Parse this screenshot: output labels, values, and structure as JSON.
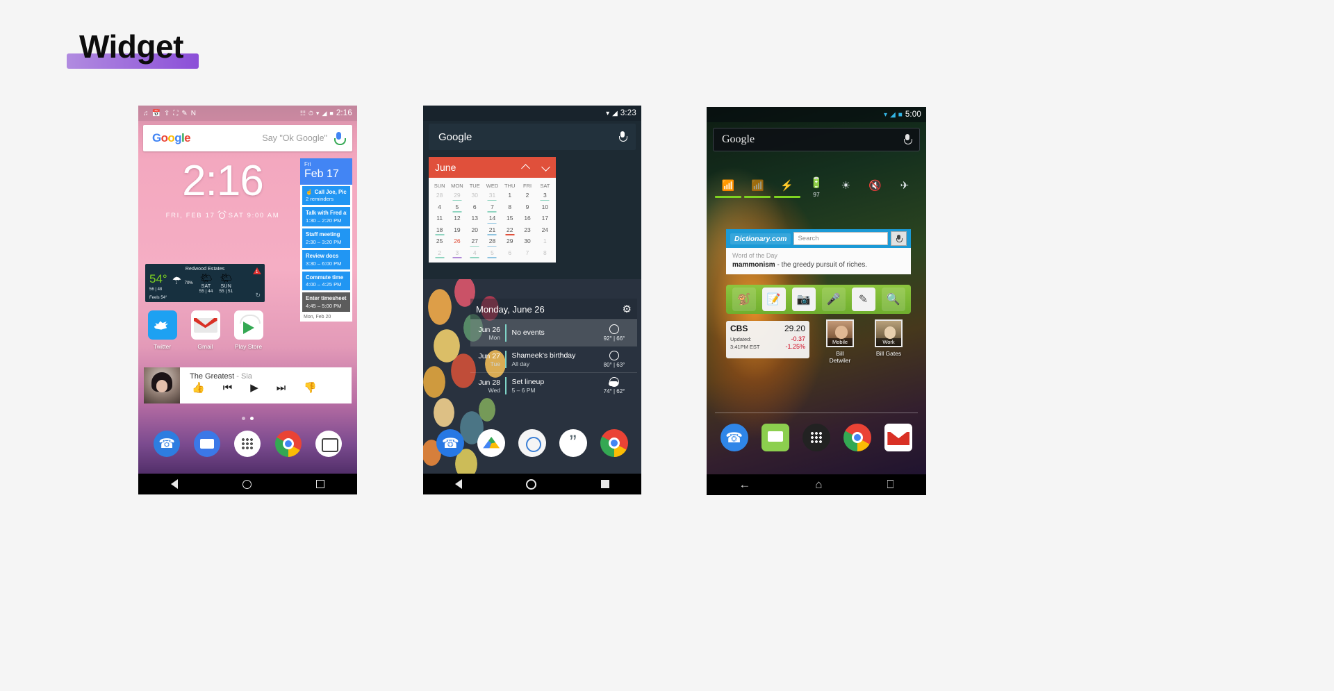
{
  "page": {
    "title": "Widget",
    "highlight_color": "#8b4fd8"
  },
  "phone1": {
    "status": {
      "time": "2:16",
      "icons": [
        "music-note-icon",
        "calendar-icon",
        "upload-icon",
        "photo-icon",
        "clipboard-icon",
        "n-icon",
        "vibrate-icon",
        "alarm-icon",
        "wifi-icon",
        "signal-icon",
        "battery-icon"
      ]
    },
    "search": {
      "logo": [
        "G",
        "o",
        "o",
        "g",
        "l",
        "e"
      ],
      "hint": "Say \"Ok Google\"",
      "mic": "mic-icon"
    },
    "clock": {
      "time": "2:16",
      "subline_date": "FRI, FEB 17",
      "subline_alarm": "SAT 9:00 AM"
    },
    "agenda": {
      "header_day": "Fri",
      "header_date": "Feb 17",
      "footer": "Mon, Feb 20",
      "items": [
        {
          "title": "Call Joe, Pick up r",
          "sub": "2 reminders",
          "style": "blue",
          "icon": "reminder-icon"
        },
        {
          "title": "Talk with Fred about",
          "sub": "1:30 – 2:20 PM",
          "style": "blue"
        },
        {
          "title": "Staff meeting",
          "sub": "2:30 – 3:20 PM",
          "style": "blue"
        },
        {
          "title": "Review docs",
          "sub": "3:30 – 6:00 PM",
          "style": "blue"
        },
        {
          "title": "Commute time",
          "sub": "4:00 – 4:25 PM",
          "style": "blue"
        },
        {
          "title": "Enter timesheets",
          "sub": "4:45 – 5:00 PM",
          "style": "gray"
        }
      ]
    },
    "weather": {
      "city": "Redwood Estates",
      "temp": "54°",
      "hi_lo": "56 | 48",
      "feels": "Feels 54°",
      "precip": "70%",
      "days": [
        {
          "label": "SAT",
          "values": "55 | 44"
        },
        {
          "label": "SUN",
          "values": "55 | 51"
        }
      ],
      "alert_badge": "1",
      "refresh": "refresh-icon"
    },
    "apps": [
      {
        "label": "Twitter",
        "icon": "twitter-icon"
      },
      {
        "label": "Gmail",
        "icon": "gmail-icon"
      },
      {
        "label": "Play Store",
        "icon": "play-store-icon"
      }
    ],
    "music": {
      "track": "The Greatest",
      "separator": " - ",
      "artist": "Sia",
      "controls": [
        "thumbs-up-icon",
        "previous-icon",
        "play-icon",
        "dislike-icon"
      ]
    },
    "dock": [
      "phone-icon",
      "messages-icon",
      "app-drawer-icon",
      "chrome-icon",
      "camera-icon"
    ],
    "nav": [
      "back-icon",
      "home-icon",
      "recents-icon"
    ]
  },
  "phone2": {
    "status": {
      "time": "3:23",
      "icons": [
        "wifi-icon",
        "signal-icon"
      ]
    },
    "search": {
      "label": "Google",
      "mic": "mic-icon"
    },
    "calendar": {
      "month": "June",
      "prev": "chevron-up-icon",
      "next": "chevron-down-icon",
      "weekdays": [
        "SUN",
        "MON",
        "TUE",
        "WED",
        "THU",
        "FRI",
        "SAT"
      ],
      "weeks": [
        [
          {
            "d": "28",
            "dim": true
          },
          {
            "d": "29",
            "dim": true,
            "mark": "green"
          },
          {
            "d": "30",
            "dim": true
          },
          {
            "d": "31",
            "dim": true,
            "mark": "green"
          },
          {
            "d": "1"
          },
          {
            "d": "2"
          },
          {
            "d": "3",
            "mark": "green"
          }
        ],
        [
          {
            "d": "4"
          },
          {
            "d": "5",
            "mark": "green"
          },
          {
            "d": "6"
          },
          {
            "d": "7",
            "mark": "green"
          },
          {
            "d": "8"
          },
          {
            "d": "9"
          },
          {
            "d": "10"
          }
        ],
        [
          {
            "d": "11"
          },
          {
            "d": "12"
          },
          {
            "d": "13"
          },
          {
            "d": "14",
            "mark": "blue"
          },
          {
            "d": "15"
          },
          {
            "d": "16"
          },
          {
            "d": "17"
          }
        ],
        [
          {
            "d": "18",
            "mark": "green"
          },
          {
            "d": "19"
          },
          {
            "d": "20"
          },
          {
            "d": "21",
            "mark": "blue"
          },
          {
            "d": "22",
            "mark": "red"
          },
          {
            "d": "23"
          },
          {
            "d": "24"
          }
        ],
        [
          {
            "d": "25"
          },
          {
            "d": "26",
            "today": true
          },
          {
            "d": "27",
            "mark": "green"
          },
          {
            "d": "28",
            "mark": "blue"
          },
          {
            "d": "29"
          },
          {
            "d": "30"
          },
          {
            "d": "1",
            "dim": true
          }
        ],
        [
          {
            "d": "2",
            "dim": true,
            "mark": "green"
          },
          {
            "d": "3",
            "dim": true,
            "mark": "purple"
          },
          {
            "d": "4",
            "dim": true,
            "mark": "green"
          },
          {
            "d": "5",
            "dim": true,
            "mark": "blue"
          },
          {
            "d": "6",
            "dim": true
          },
          {
            "d": "7",
            "dim": true
          },
          {
            "d": "8",
            "dim": true
          }
        ]
      ]
    },
    "agenda": {
      "title": "Monday, June 26",
      "settings": "gear-icon",
      "rows": [
        {
          "date": "Jun 26",
          "weekday": "Mon",
          "title": "No events",
          "sub": "",
          "weather_icon": "sunny-icon",
          "weather_text": "92° | 66°",
          "highlighted": true
        },
        {
          "date": "Jun 27",
          "weekday": "Tue",
          "title": "Shameek's birthday",
          "sub": "All day",
          "weather_icon": "sunny-icon",
          "weather_text": "80° | 63°",
          "highlighted": false
        },
        {
          "date": "Jun 28",
          "weekday": "Wed",
          "title": "Set lineup",
          "sub": "5 – 6 PM",
          "weather_icon": "partly-cloudy-icon",
          "weather_text": "74° | 62°",
          "highlighted": false
        }
      ]
    },
    "dock": [
      "phone-icon",
      "drive-icon",
      "camera-icon",
      "quote-icon",
      "chrome-icon"
    ],
    "nav": [
      "back-icon",
      "home-icon",
      "recents-icon"
    ]
  },
  "phone3": {
    "status": {
      "time": "5:00",
      "icons": [
        "wifi-icon",
        "signal-icon",
        "battery-icon"
      ]
    },
    "search": {
      "logo": "Google",
      "mic": "mic-icon"
    },
    "toggles": [
      {
        "icon": "wifi-icon",
        "state": "on",
        "label": ""
      },
      {
        "icon": "wifi-off-icon",
        "state": "on",
        "label": ""
      },
      {
        "icon": "bluetooth-icon",
        "state": "on",
        "label": ""
      },
      {
        "icon": "battery-icon",
        "state": "off",
        "label": "97"
      },
      {
        "icon": "brightness-icon",
        "state": "off",
        "label": ""
      },
      {
        "icon": "volume-mute-icon",
        "state": "off",
        "label": ""
      },
      {
        "icon": "airplane-icon",
        "state": "off",
        "label": ""
      }
    ],
    "dictionary": {
      "brand": "Dictionary.com",
      "search_placeholder": "Search",
      "mic": "mic-icon",
      "wotd_label": "Word of the Day",
      "word": "mammonism",
      "definition": " - the greedy pursuit of riches."
    },
    "evernote_tools": [
      "evernote-icon",
      "new-note-icon",
      "snapshot-icon",
      "audio-note-icon",
      "handwriting-icon",
      "search-icon"
    ],
    "stock": {
      "symbol": "CBS",
      "price": "29.20",
      "updated_label": "Updated:",
      "change": "-0.37",
      "time": "3:41PM EST",
      "percent": "-1.25%"
    },
    "contacts": [
      {
        "name": "Bill Detwiler",
        "tag": "Mobile"
      },
      {
        "name": "Bill Gates",
        "tag": "Work"
      }
    ],
    "dock": [
      "phone-icon",
      "messages-icon",
      "app-drawer-icon",
      "chrome-icon",
      "gmail-icon"
    ],
    "nav": [
      "back-icon",
      "home-icon",
      "recents-icon"
    ]
  }
}
